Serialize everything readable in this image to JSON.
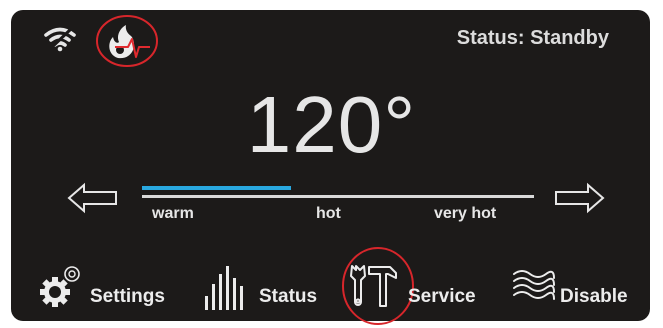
{
  "status": {
    "text": "Status: Standby"
  },
  "temperature": {
    "value": "120°",
    "level": 0.38
  },
  "scale": {
    "labels": [
      "warm",
      "hot",
      "very hot"
    ]
  },
  "nav": [
    {
      "label": "Settings",
      "icon": "gear-icon"
    },
    {
      "label": "Status",
      "icon": "bar-chart-icon"
    },
    {
      "label": "Service",
      "icon": "tools-icon"
    },
    {
      "label": "Disable",
      "icon": "waves-icon"
    }
  ],
  "indicators": {
    "wifi": "wifi-off-icon",
    "flame": "flame-activity-icon"
  },
  "colors": {
    "background": "#1c1a19",
    "text": "#e6e6e6",
    "accent": "#29a8e0",
    "highlight": "#d7262b"
  }
}
